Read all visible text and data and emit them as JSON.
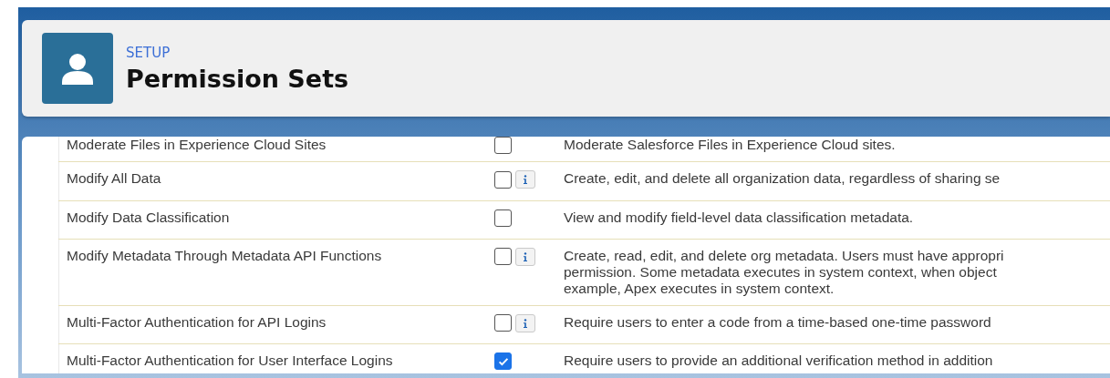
{
  "header": {
    "eyebrow": "SETUP",
    "title": "Permission Sets"
  },
  "rows": [
    {
      "name": "Moderate Files in Experience Cloud Sites",
      "checked": false,
      "info": false,
      "description": [
        "Moderate Salesforce Files in Experience Cloud sites."
      ]
    },
    {
      "name": "Modify All Data",
      "checked": false,
      "info": true,
      "description": [
        "Create, edit, and delete all organization data, regardless of sharing se"
      ]
    },
    {
      "name": "Modify Data Classification",
      "checked": false,
      "info": false,
      "description": [
        "View and modify field-level data classification metadata."
      ]
    },
    {
      "name": "Modify Metadata Through Metadata API Functions",
      "checked": false,
      "info": true,
      "description": [
        "Create, read, edit, and delete org metadata. Users must have appropri",
        "permission. Some metadata executes in system context, when object",
        "example, Apex executes in system context."
      ]
    },
    {
      "name": "Multi-Factor Authentication for API Logins",
      "checked": false,
      "info": true,
      "description": [
        "Require users to enter a code from a time-based one-time password"
      ]
    },
    {
      "name": "Multi-Factor Authentication for User Interface Logins",
      "checked": true,
      "info": false,
      "description": [
        "Require users to provide an additional verification method in addition"
      ]
    }
  ]
}
